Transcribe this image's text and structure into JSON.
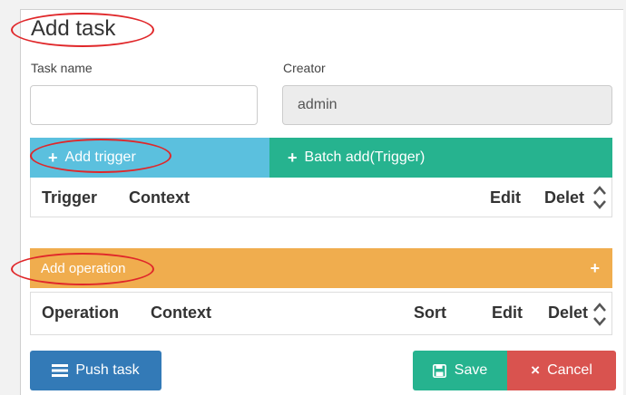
{
  "dialog": {
    "title": "Add task"
  },
  "form": {
    "task_name_label": "Task name",
    "task_name_value": "",
    "creator_label": "Creator",
    "creator_value": "admin"
  },
  "triggers": {
    "add_label": "Add trigger",
    "batch_label": "Batch add(Trigger)",
    "columns": [
      "Trigger",
      "Context",
      "Edit",
      "Delet"
    ]
  },
  "operations": {
    "add_label": "Add operation",
    "columns": [
      "Operation",
      "Context",
      "Sort",
      "Edit",
      "Delet"
    ]
  },
  "footer": {
    "push_label": "Push task",
    "save_label": "Save",
    "cancel_label": "Cancel"
  },
  "colors": {
    "trigger_blue": "#5bc0de",
    "batch_green": "#26b38f",
    "operation_orange": "#f0ad4e",
    "push_blue": "#337ab7",
    "save_green": "#26b38f",
    "cancel_red": "#d9534f",
    "annotation_red": "#e0272a"
  },
  "icons": {
    "plus": "+",
    "save": "floppy-icon",
    "cancel": "×",
    "push": "list-icon"
  }
}
